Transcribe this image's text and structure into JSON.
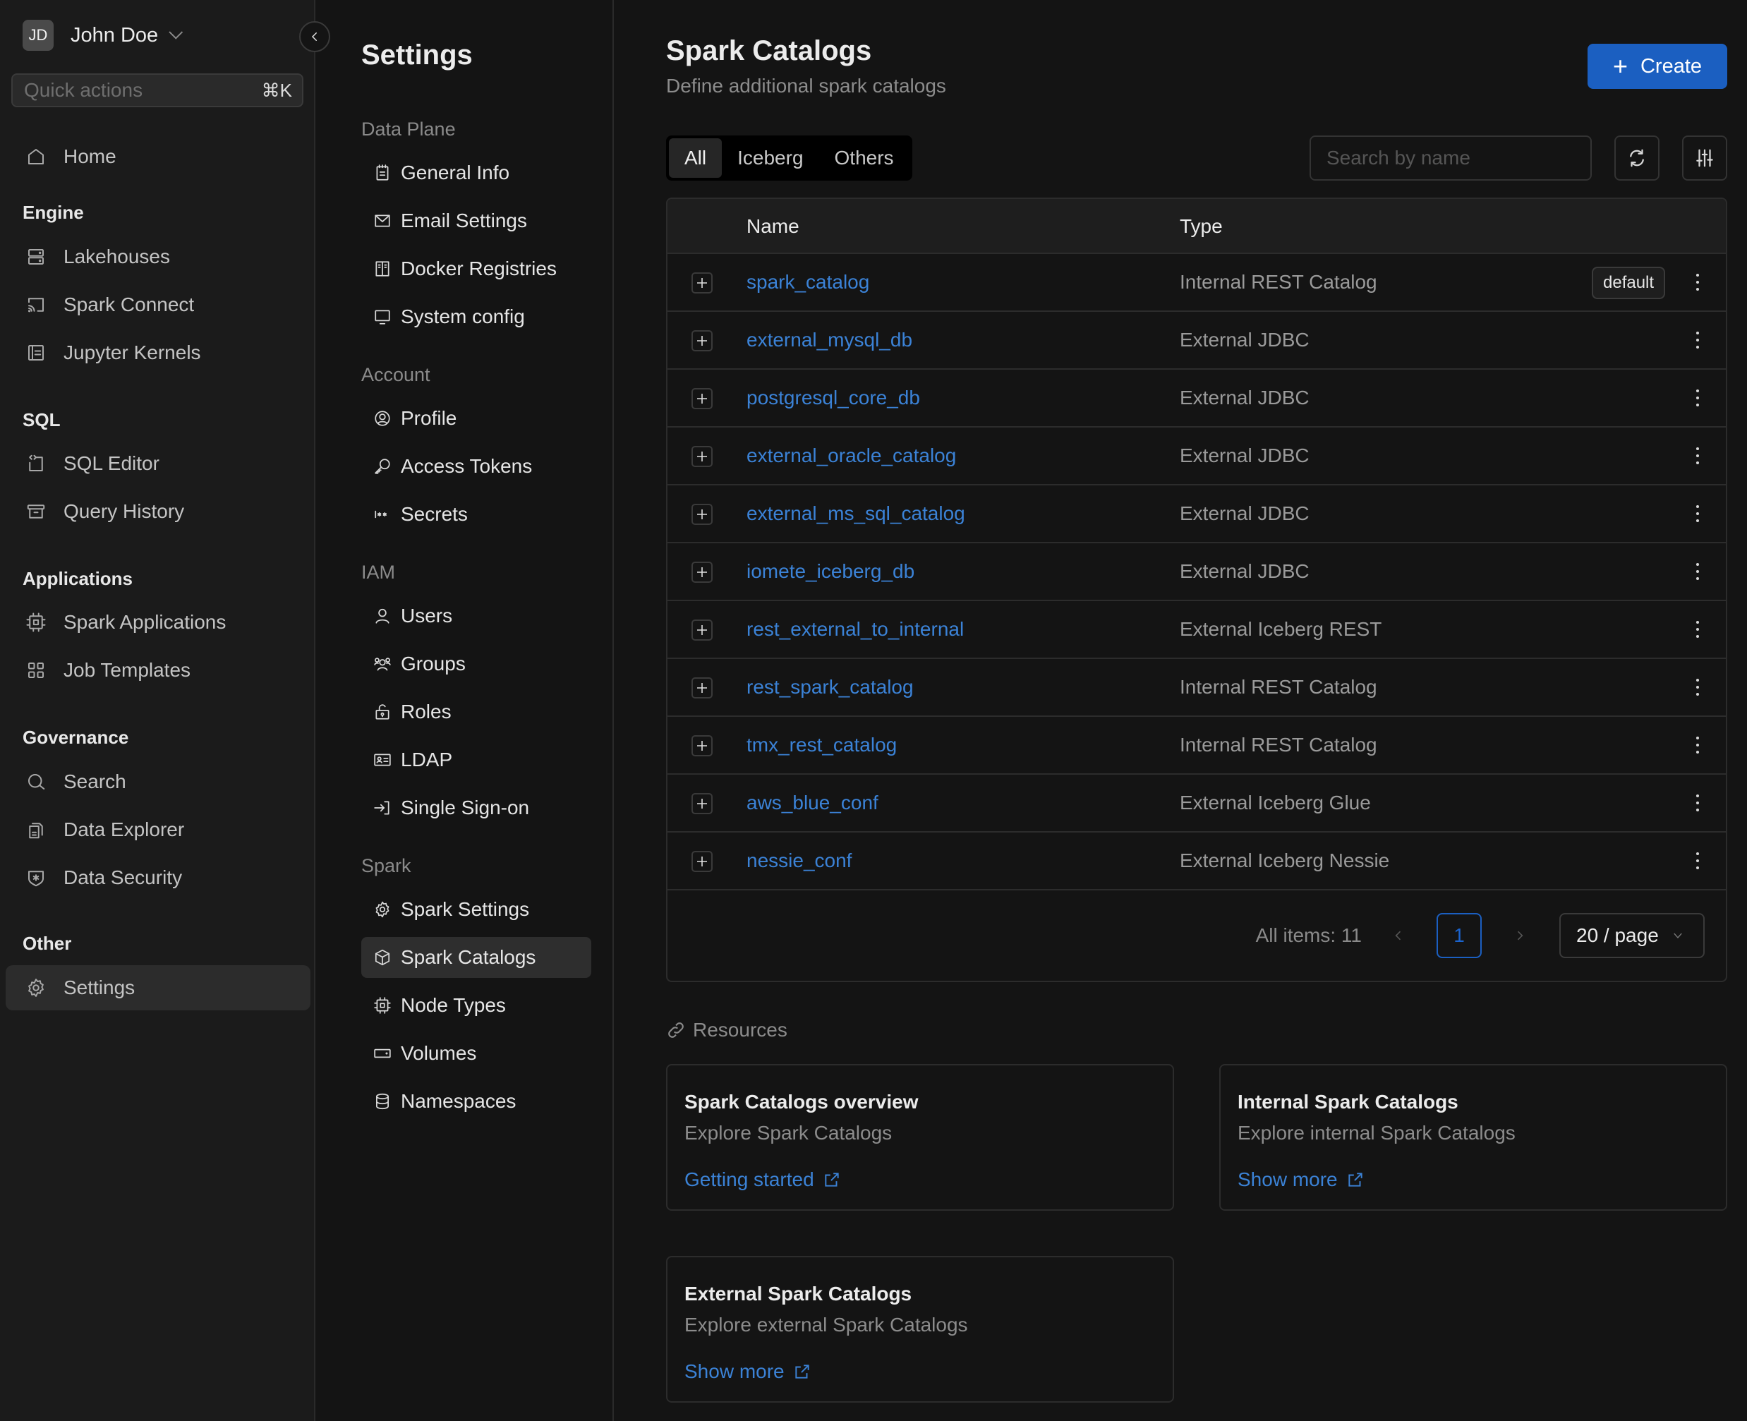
{
  "user": {
    "initials": "JD",
    "name": "John Doe"
  },
  "quick_actions": {
    "placeholder": "Quick actions",
    "shortcut": "⌘K"
  },
  "sidebar": {
    "home": {
      "label": "Home",
      "icon": "home-icon"
    },
    "sections": [
      {
        "title": "Engine",
        "items": [
          {
            "label": "Lakehouses",
            "icon": "server-icon"
          },
          {
            "label": "Spark Connect",
            "icon": "cast-icon"
          },
          {
            "label": "Jupyter Kernels",
            "icon": "notebook-icon"
          }
        ]
      },
      {
        "title": "SQL",
        "items": [
          {
            "label": "SQL Editor",
            "icon": "code-editor-icon"
          },
          {
            "label": "Query History",
            "icon": "archive-icon"
          }
        ]
      },
      {
        "title": "Applications",
        "items": [
          {
            "label": "Spark Applications",
            "icon": "chip-icon"
          },
          {
            "label": "Job Templates",
            "icon": "grid-icon"
          }
        ]
      },
      {
        "title": "Governance",
        "items": [
          {
            "label": "Search",
            "icon": "search-icon"
          },
          {
            "label": "Data Explorer",
            "icon": "files-icon"
          },
          {
            "label": "Data Security",
            "icon": "shield-icon"
          }
        ]
      },
      {
        "title": "Other",
        "items": [
          {
            "label": "Settings",
            "icon": "gear-icon",
            "active": true
          }
        ]
      }
    ]
  },
  "settings_nav": {
    "title": "Settings",
    "sections": [
      {
        "title": "Data Plane",
        "items": [
          {
            "label": "General Info",
            "icon": "notepad-icon"
          },
          {
            "label": "Email Settings",
            "icon": "mail-icon"
          },
          {
            "label": "Docker Registries",
            "icon": "registry-icon"
          },
          {
            "label": "System config",
            "icon": "monitor-icon"
          }
        ]
      },
      {
        "title": "Account",
        "items": [
          {
            "label": "Profile",
            "icon": "user-circle-icon"
          },
          {
            "label": "Access Tokens",
            "icon": "key-icon"
          },
          {
            "label": "Secrets",
            "icon": "password-icon"
          }
        ]
      },
      {
        "title": "IAM",
        "items": [
          {
            "label": "Users",
            "icon": "user-icon"
          },
          {
            "label": "Groups",
            "icon": "users-icon"
          },
          {
            "label": "Roles",
            "icon": "lock-icon"
          },
          {
            "label": "LDAP",
            "icon": "id-card-icon"
          },
          {
            "label": "Single Sign-on",
            "icon": "login-icon"
          }
        ]
      },
      {
        "title": "Spark",
        "items": [
          {
            "label": "Spark Settings",
            "icon": "gear-icon"
          },
          {
            "label": "Spark Catalogs",
            "icon": "cube-icon",
            "active": true
          },
          {
            "label": "Node Types",
            "icon": "chip-icon"
          },
          {
            "label": "Volumes",
            "icon": "drive-icon"
          },
          {
            "label": "Namespaces",
            "icon": "database-icon"
          }
        ]
      }
    ]
  },
  "page": {
    "title": "Spark Catalogs",
    "subtitle": "Define additional spark catalogs",
    "create_label": "Create",
    "tabs": [
      {
        "label": "All",
        "active": true
      },
      {
        "label": "Iceberg"
      },
      {
        "label": "Others"
      }
    ],
    "search_placeholder": "Search by name",
    "search_value": ""
  },
  "table": {
    "columns": [
      "Name",
      "Type"
    ],
    "rows": [
      {
        "name": "spark_catalog",
        "type": "Internal REST Catalog",
        "badge": "default"
      },
      {
        "name": "external_mysql_db",
        "type": "External JDBC"
      },
      {
        "name": "postgresql_core_db",
        "type": "External JDBC"
      },
      {
        "name": "external_oracle_catalog",
        "type": "External JDBC"
      },
      {
        "name": "external_ms_sql_catalog",
        "type": "External JDBC"
      },
      {
        "name": "iomete_iceberg_db",
        "type": "External JDBC"
      },
      {
        "name": "rest_external_to_internal",
        "type": "External Iceberg REST"
      },
      {
        "name": "rest_spark_catalog",
        "type": "Internal REST Catalog"
      },
      {
        "name": "tmx_rest_catalog",
        "type": "Internal REST Catalog"
      },
      {
        "name": "aws_blue_conf",
        "type": "External Iceberg Glue"
      },
      {
        "name": "nessie_conf",
        "type": "External Iceberg Nessie"
      }
    ]
  },
  "pagination": {
    "total_label": "All items: 11",
    "current_page": "1",
    "page_size": "20 / page"
  },
  "resources": {
    "title": "Resources",
    "cards": [
      {
        "title": "Spark Catalogs overview",
        "description": "Explore Spark Catalogs",
        "link": "Getting started"
      },
      {
        "title": "Internal Spark Catalogs",
        "description": "Explore internal Spark Catalogs",
        "link": "Show more"
      },
      {
        "title": "External Spark Catalogs",
        "description": "Explore external Spark Catalogs",
        "link": "Show more"
      }
    ]
  },
  "colors": {
    "accent": "#1b5fc1",
    "link": "#3b82d6",
    "sidebar_bg": "#1b1b1b",
    "content_bg": "#141414"
  }
}
